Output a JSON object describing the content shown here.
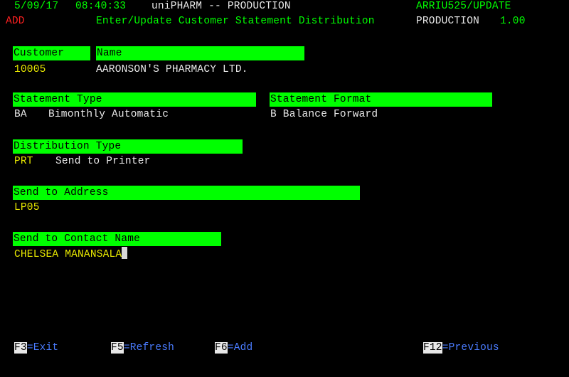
{
  "status_bar": {
    "date": "5/09/17",
    "time": "08:40:33",
    "system": "uniPHARM -- PRODUCTION",
    "program": "ARRIU525/UPDATE",
    "mode": "ADD",
    "screen_title": "Enter/Update Customer Statement Distribution",
    "environment": "PRODUCTION",
    "version": "1.00"
  },
  "fields": {
    "customer": {
      "label": "Customer",
      "value": "10005"
    },
    "name": {
      "label": "Name",
      "value": "AARONSON'S PHARMACY LTD."
    },
    "statement_type": {
      "label": "Statement Type",
      "code": "BA",
      "description": "Bimonthly Automatic"
    },
    "statement_format": {
      "label": "Statement Format",
      "value": "B Balance Forward"
    },
    "distribution_type": {
      "label": "Distribution Type",
      "code": "PRT",
      "description": "Send to Printer"
    },
    "send_to_address": {
      "label": "Send to Address",
      "value": "LP05"
    },
    "send_to_contact": {
      "label": "Send to Contact Name",
      "value": "CHELSEA MANANSALA"
    }
  },
  "function_keys": [
    {
      "key": "F3",
      "label": "=Exit"
    },
    {
      "key": "F5",
      "label": "=Refresh"
    },
    {
      "key": "F6",
      "label": "=Add"
    },
    {
      "key": "F12",
      "label": "=Previous"
    }
  ],
  "colors": {
    "background": "#000000",
    "header_bar": "#00ff00",
    "label_text": "#000000",
    "system_text": "#00ff00",
    "value_text": "#e8e8e8",
    "input_text": "#e8e800",
    "mode_text": "#ff2020",
    "fkey_text": "#4a7cff"
  }
}
